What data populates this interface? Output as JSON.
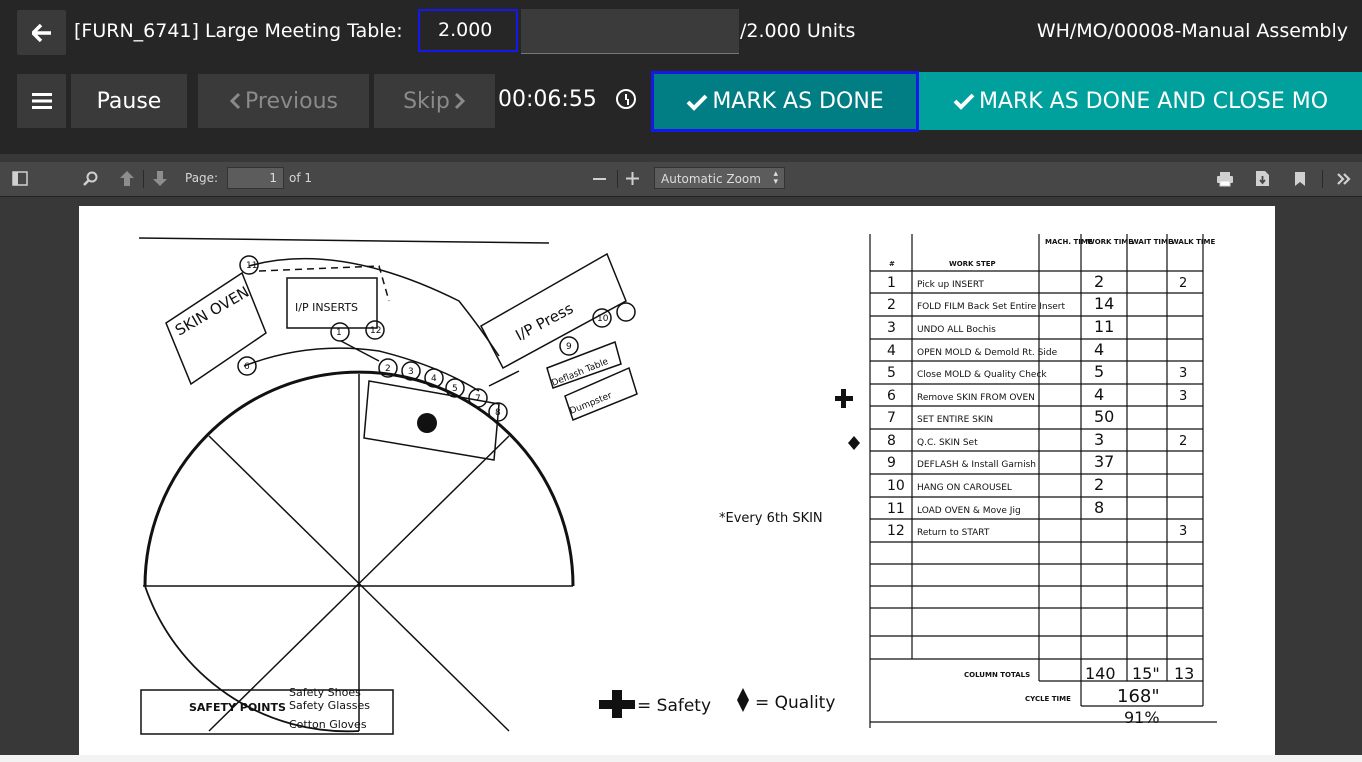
{
  "header": {
    "back_icon": "arrow-left-icon",
    "title": "[FURN_6741] Large Meeting Table:",
    "qty_value": "2.000",
    "units": "/2.000 Units",
    "mo_ref": "WH/MO/00008-Manual Assembly"
  },
  "toolbar": {
    "menu_icon": "hamburger-icon",
    "pause_label": "Pause",
    "previous_label": "Previous",
    "skip_label": "Skip",
    "timer": "00:06:55",
    "done_label": "MARK AS DONE",
    "done_close_label": "MARK AS DONE AND CLOSE MO"
  },
  "pdf": {
    "page_label": "Page:",
    "page_value": "1",
    "of_label": "of 1",
    "zoom_value": "Automatic Zoom",
    "icons": [
      "sidebar-toggle-icon",
      "search-icon",
      "prev-page-icon",
      "next-page-icon",
      "zoom-out-icon",
      "zoom-in-icon",
      "print-icon",
      "download-icon",
      "bookmark-icon",
      "tools-icon"
    ]
  },
  "document": {
    "layout_labels": {
      "skin_oven": "SKIN OVEN",
      "ip_inserts": "I/P INSERTS",
      "ip_press": "I/P Press",
      "deflash_table": "Deflash Table",
      "dumpster": "Dumpster",
      "safety_points_label": "SAFETY POINTS",
      "safety_items": [
        "Safety Shoes",
        "Safety Glasses",
        "Cotton Gloves"
      ],
      "every_note": "*Every 6th SKIN",
      "legend_safety": "= Safety",
      "legend_quality": "= Quality"
    },
    "table": {
      "headers": [
        "#",
        "WORK STEP",
        "MACH. TIME",
        "WORK TIME",
        "WAIT TIME",
        "WALK TIME"
      ],
      "rows": [
        {
          "n": "1",
          "step": "Pick up INSERT",
          "work": "2",
          "walk": "2"
        },
        {
          "n": "2",
          "step": "FOLD FILM Back Set Entire Insert",
          "work": "14",
          "walk": ""
        },
        {
          "n": "3",
          "step": "UNDO ALL Bochis",
          "work": "11",
          "walk": ""
        },
        {
          "n": "4",
          "step": "OPEN MOLD & Demold Rt. Side",
          "work": "4",
          "walk": ""
        },
        {
          "n": "5",
          "step": "Close MOLD & Quality Check",
          "work": "5",
          "walk": "3"
        },
        {
          "n": "6",
          "step": "Remove SKIN FROM OVEN",
          "work": "4",
          "walk": "3"
        },
        {
          "n": "7",
          "step": "SET ENTIRE SKIN",
          "work": "50",
          "walk": ""
        },
        {
          "n": "8",
          "step": "Q.C. SKIN Set",
          "work": "3",
          "walk": "2"
        },
        {
          "n": "9",
          "step": "DEFLASH & Install Garnish",
          "work": "37",
          "walk": ""
        },
        {
          "n": "10",
          "step": "HANG ON CAROUSEL",
          "work": "2",
          "walk": ""
        },
        {
          "n": "11",
          "step": "LOAD OVEN & Move Jig",
          "work": "8",
          "walk": ""
        },
        {
          "n": "12",
          "step": "Return to START",
          "work": "",
          "walk": "3"
        }
      ],
      "column_totals_label": "COLUMN TOTALS",
      "total_work": "140",
      "total_wait": "15\"",
      "total_walk": "13",
      "cycle_time_label": "CYCLE TIME",
      "cycle_time": "168\"",
      "percent": "91%"
    }
  }
}
